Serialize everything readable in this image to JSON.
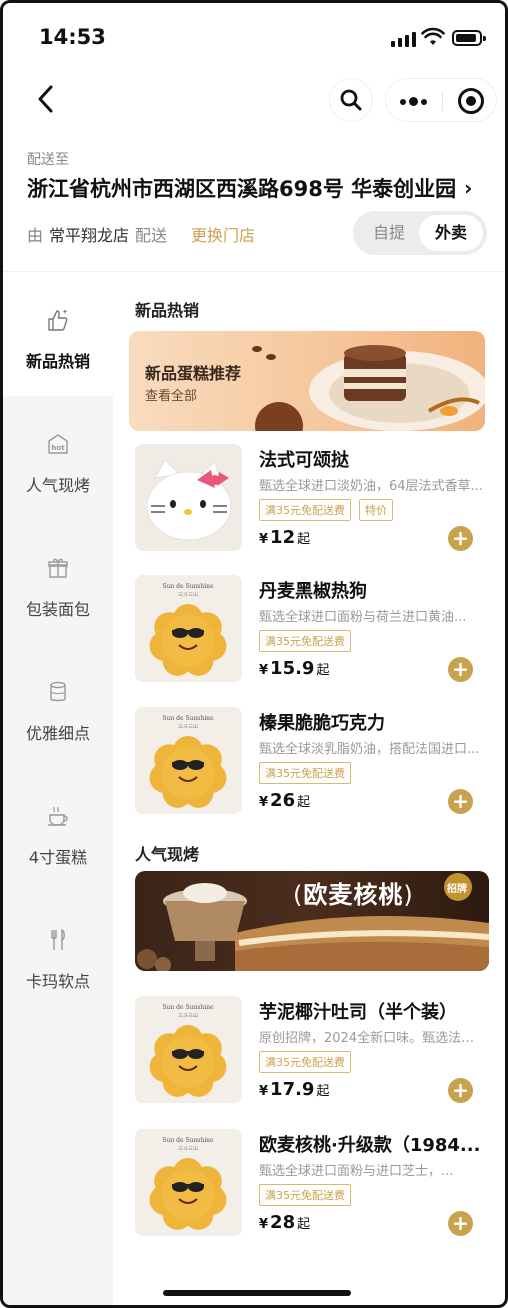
{
  "status_bar": {
    "time": "14:53"
  },
  "delivery": {
    "label": "配送至",
    "address": "浙江省杭州市西湖区西溪路698号 华泰创业园",
    "by": "由",
    "store": "常平翔龙店",
    "delivers": "配送",
    "change_store": "更换门店",
    "modes": [
      "自提",
      "外卖"
    ],
    "selected_mode": "外卖"
  },
  "sidebar": {
    "items": [
      {
        "label": "新品热销",
        "icon": "thumbs-up-icon",
        "active": true
      },
      {
        "label": "人气现烤",
        "icon": "hot-oven-icon",
        "active": false
      },
      {
        "label": "包装面包",
        "icon": "gift-box-icon",
        "active": false
      },
      {
        "label": "优雅细点",
        "icon": "jar-icon",
        "active": false
      },
      {
        "label": "4寸蛋糕",
        "icon": "hot-drink-icon",
        "active": false
      },
      {
        "label": "卡玛软点",
        "icon": "cutlery-icon",
        "active": false
      }
    ]
  },
  "sections": [
    {
      "title": "新品热销",
      "banner": {
        "title": "新品蛋糕推荐",
        "subtitle": "查看全部"
      },
      "products": [
        {
          "name": "法式可颂挞",
          "desc": "甄选全球进口淡奶油，64层法式香草...",
          "tags": [
            "满35元免配送费",
            "特价"
          ],
          "currency": "¥",
          "price": "12",
          "suffix": "起"
        },
        {
          "name": "丹麦黑椒热狗",
          "desc": "甄选全球进口面粉与荷兰进口黄油...",
          "tags": [
            "满35元免配送费"
          ],
          "currency": "¥",
          "price": "15.9",
          "suffix": "起"
        },
        {
          "name": "榛果脆脆巧克力",
          "desc": "甄选全球淡乳脂奶油，搭配法国进口...",
          "tags": [
            "满35元免配送费"
          ],
          "currency": "¥",
          "price": "26",
          "suffix": "起"
        }
      ]
    },
    {
      "title": "人气现烤",
      "banner": {
        "title": "欧麦核桃",
        "badge": "招牌"
      },
      "products": [
        {
          "name": "芋泥椰汁吐司（半个装）",
          "desc": "原创招牌，2024全新口味。甄选法国...",
          "tags": [
            "满35元免配送费"
          ],
          "currency": "¥",
          "price": "17.9",
          "suffix": "起"
        },
        {
          "name": "欧麦核桃·升级款（1984...",
          "desc": "甄选全球进口面粉与进口芝士，...",
          "tags": [
            "满35元免配送费"
          ],
          "currency": "¥",
          "price": "28",
          "suffix": "起"
        }
      ]
    }
  ],
  "brand_mark": {
    "line1": "Sun de Sunshine",
    "line2": "三斗三山"
  },
  "colors": {
    "accent": "#c9a24d",
    "sidebar_bg": "#f5f5f5"
  }
}
